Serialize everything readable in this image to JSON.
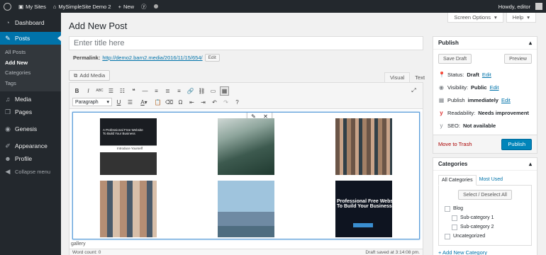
{
  "adminbar": {
    "my_sites": "My Sites",
    "site_name": "MySimpleSite Demo 2",
    "new_label": "New",
    "howdy": "Howdy, editor"
  },
  "sidebar": {
    "dashboard": "Dashboard",
    "posts": "Posts",
    "submenu": [
      "All Posts",
      "Add New",
      "Categories",
      "Tags"
    ],
    "media": "Media",
    "pages": "Pages",
    "genesis": "Genesis",
    "appearance": "Appearance",
    "profile": "Profile",
    "collapse": "Collapse menu"
  },
  "header": {
    "screen_options": "Screen Options",
    "help": "Help",
    "page_title": "Add New Post"
  },
  "title_field": {
    "placeholder": "Enter title here"
  },
  "permalink": {
    "label": "Permalink:",
    "url": "http://demo2.barn2.media/2016/11/15/654/",
    "edit": "Edit"
  },
  "editor": {
    "add_media": "Add Media",
    "tab_visual": "Visual",
    "tab_text": "Text",
    "format_select": "Paragraph",
    "gallery_thumbs": [
      {
        "heading": "A Professional Free Website",
        "sub": "To Build Your Business",
        "caption": "Introduce Yourself"
      },
      {
        "heading": "Professional Free Webs",
        "sub": "To Build Your Business"
      }
    ],
    "path": "gallery",
    "word_count": "Word count: 0",
    "draft_saved": "Draft saved at 3:14:08 pm."
  },
  "publish": {
    "title": "Publish",
    "save_draft": "Save Draft",
    "preview": "Preview",
    "status_label": "Status:",
    "status_value": "Draft",
    "visibility_label": "Visibility:",
    "visibility_value": "Public",
    "publish_label": "Publish",
    "publish_value": "immediately",
    "edit": "Edit",
    "readability_label": "Readability:",
    "readability_value": "Needs improvement",
    "seo_label": "SEO:",
    "seo_value": "Not available",
    "trash": "Move to Trash",
    "publish_button": "Publish"
  },
  "categories": {
    "title": "Categories",
    "tab_all": "All Categories",
    "tab_most": "Most Used",
    "select_all": "Select / Deselect All",
    "items": [
      "Blog",
      "Sub-category 1",
      "Sub-category 2",
      "Uncategorized"
    ],
    "add_new": "+ Add New Category"
  }
}
